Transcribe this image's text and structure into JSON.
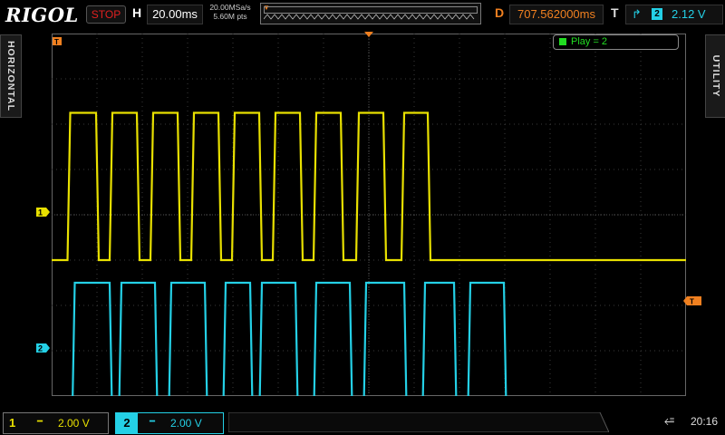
{
  "brand": "RIGOL",
  "acquisition": {
    "status": "STOP"
  },
  "horizontal": {
    "label": "H",
    "scale": "20.00ms",
    "sample_rate": "20.00MSa/s",
    "memory_depth": "5.60M pts"
  },
  "delay": {
    "label": "D",
    "value": "707.562000ms"
  },
  "trigger": {
    "label": "T",
    "edge_icon": "rising-edge-icon",
    "source": "2",
    "level": "2.12 V"
  },
  "side_tabs": {
    "left": "HORIZONTAL",
    "right": "UTILITY"
  },
  "playback": {
    "label": "Play = 2"
  },
  "channels": [
    {
      "number": "1",
      "coupling_icon": "dc-coupling-icon",
      "scale": "2.00 V",
      "color": "#e8e000"
    },
    {
      "number": "2",
      "coupling_icon": "dc-coupling-icon",
      "scale": "2.00 V",
      "color": "#24d0e6"
    }
  ],
  "markers": {
    "ch1": "1",
    "ch2": "2"
  },
  "status": {
    "usb_icon": "usb-icon",
    "time": "20:16"
  },
  "colors": {
    "ch1": "#e8e000",
    "ch2": "#24d0e6",
    "trigger": "#f08020",
    "grid": "#3a3a3a"
  },
  "waveforms": {
    "ch1": {
      "low_div": 5.0,
      "high_div": 1.75,
      "transitions": [
        0.35,
        0.98,
        1.28,
        1.88,
        2.18,
        2.78,
        3.08,
        3.68,
        3.98,
        4.58,
        4.88,
        5.48,
        5.78,
        6.38,
        6.72,
        7.32,
        7.72,
        8.3
      ]
    },
    "ch2": {
      "low_div": 8.75,
      "high_div": 5.5,
      "transitions": [
        0.45,
        1.28,
        1.48,
        2.28,
        2.58,
        3.38,
        3.78,
        4.38,
        4.58,
        5.38,
        5.78,
        6.58,
        6.88,
        7.78,
        8.18,
        8.88,
        9.18,
        9.98
      ]
    }
  }
}
